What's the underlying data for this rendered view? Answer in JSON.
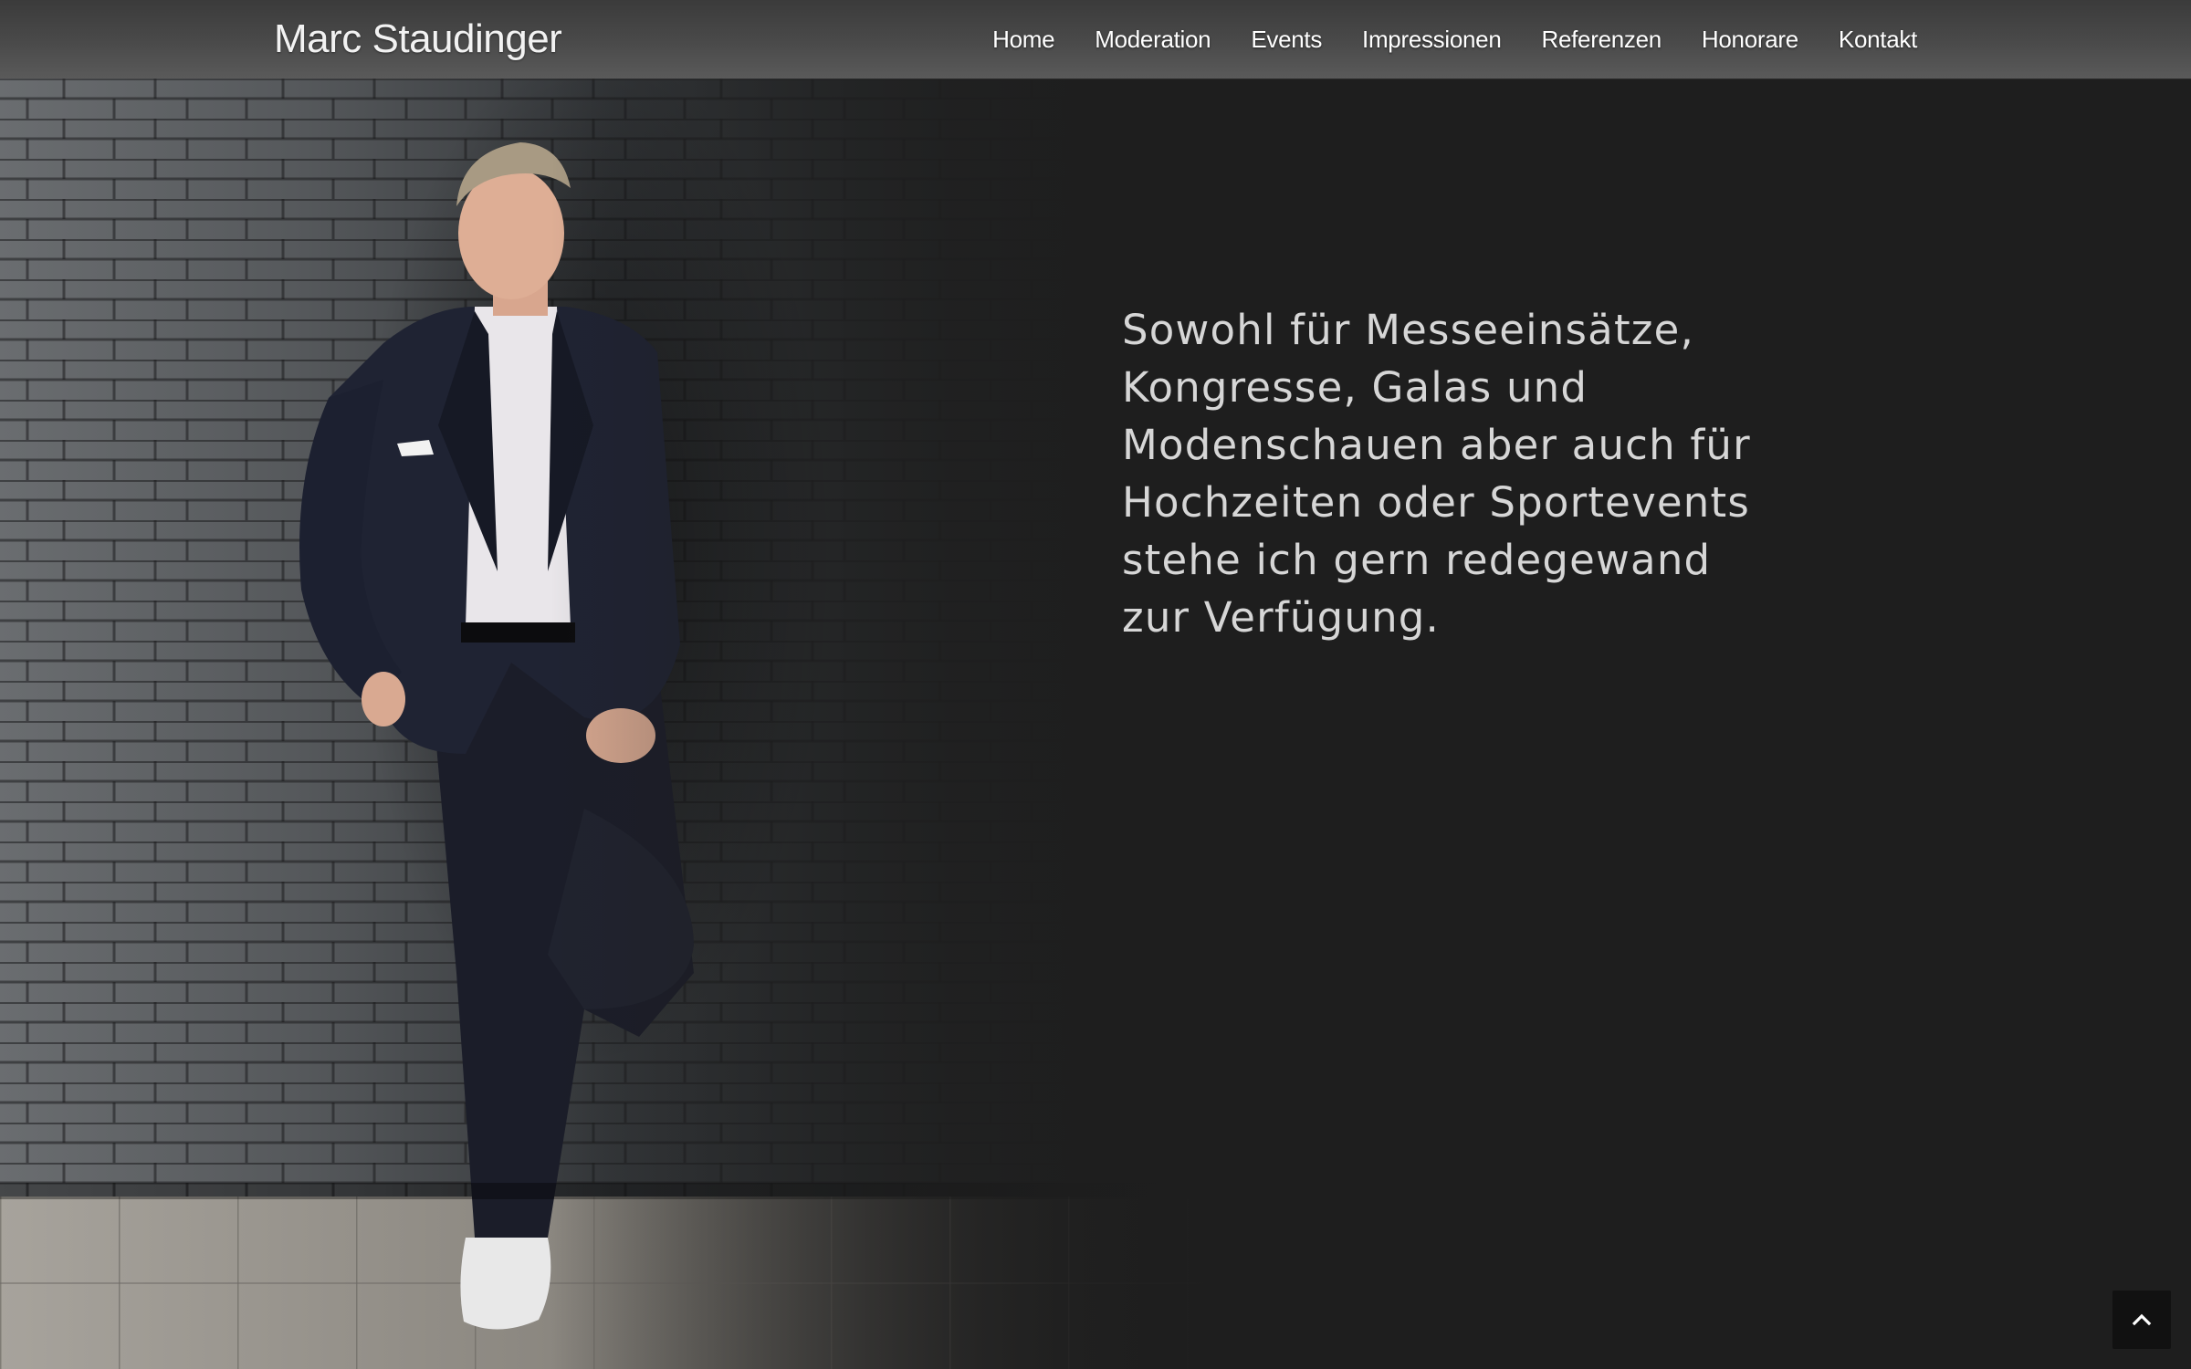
{
  "header": {
    "brand": "Marc Staudinger",
    "nav": [
      "Home",
      "Moderation",
      "Events",
      "Impressionen",
      "Referenzen",
      "Honorare",
      "Kontakt"
    ]
  },
  "intro": {
    "text": "Sowohl für Messeeinsätze, Kongresse, Galas und Modenschauen aber auch für Hochzeiten oder Sportevents stehe ich gern redegewand zur Verfügung."
  },
  "icons": {
    "scroll_top": "chevron-up-icon"
  },
  "colors": {
    "background": "#1e1e1e",
    "header": "#4a4a4a",
    "text": "#d6d6d6"
  }
}
